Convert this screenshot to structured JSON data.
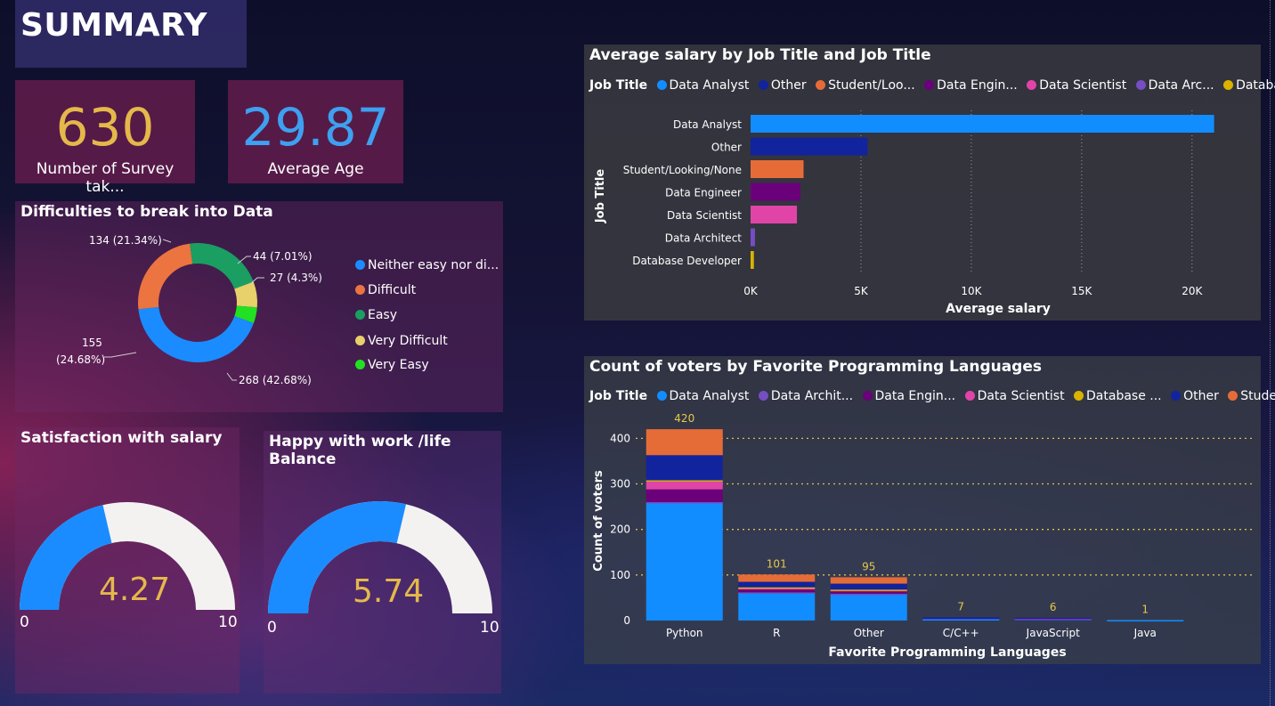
{
  "page_title": "SUMMARY",
  "kpis": {
    "surveys": {
      "value": "630",
      "label": "Number of Survey tak..."
    },
    "age": {
      "value": "29.87",
      "label": "Average Age"
    }
  },
  "colors": {
    "kpi_survey": "#e5b84a",
    "kpi_age": "#3ea0f0",
    "gauge_fill": "#1a8cff",
    "gauge_empty": "#f3f2f1",
    "gauge_value": "#e5b84a"
  },
  "difficulty": {
    "title": "Difficulties to break into Data",
    "legend": [
      {
        "label": "Neither easy nor di...",
        "color": "#1a8cff"
      },
      {
        "label": "Difficult",
        "color": "#ec7440"
      },
      {
        "label": "Easy",
        "color": "#1a9e62"
      },
      {
        "label": "Very Difficult",
        "color": "#e8d06a"
      },
      {
        "label": "Very Easy",
        "color": "#22e022"
      }
    ],
    "slice_labels": {
      "easy": "134 (21.34%)",
      "very_difficult": "44 (7.01%)",
      "very_easy": "27 (4.3%)",
      "difficult_count": "155",
      "difficult_pct": "(24.68%)",
      "neither": "268 (42.68%)"
    }
  },
  "gauges": {
    "salary": {
      "title": "Satisfaction with salary",
      "value": "4.27",
      "min": "0",
      "max": "10"
    },
    "balance": {
      "title": "Happy with work /life Balance",
      "value": "5.74",
      "min": "0",
      "max": "10"
    }
  },
  "salary_chart": {
    "title": "Average salary by Job Title and Job Title",
    "legend_title": "Job Title",
    "legend": [
      {
        "label": "Data Analyst",
        "color": "#118dff"
      },
      {
        "label": "Other",
        "color": "#12239e"
      },
      {
        "label": "Student/Loo...",
        "color": "#e66c37"
      },
      {
        "label": "Data Engin...",
        "color": "#6b007b"
      },
      {
        "label": "Data Scientist",
        "color": "#e044a7"
      },
      {
        "label": "Data Arc...",
        "color": "#744ec2"
      },
      {
        "label": "Database ...",
        "color": "#d9b300"
      }
    ],
    "ylabel": "Job Title",
    "xlabel": "Average salary",
    "ticks": [
      "0K",
      "5K",
      "10K",
      "15K",
      "20K"
    ]
  },
  "voters_chart": {
    "title": "Count of voters by Favorite Programming Languages",
    "legend_title": "Job Title",
    "legend": [
      {
        "label": "Data Analyst",
        "color": "#118dff"
      },
      {
        "label": "Data Archit...",
        "color": "#744ec2"
      },
      {
        "label": "Data Engin...",
        "color": "#6b007b"
      },
      {
        "label": "Data Scientist",
        "color": "#e044a7"
      },
      {
        "label": "Database ...",
        "color": "#d9b300"
      },
      {
        "label": "Other",
        "color": "#12239e"
      },
      {
        "label": "Student/L...",
        "color": "#e66c37"
      }
    ],
    "ylabel": "Count of voters",
    "xlabel": "Favorite Programming Languages"
  },
  "chart_data": [
    {
      "type": "pie",
      "title": "Difficulties to break into Data",
      "categories": [
        "Neither easy nor difficult",
        "Difficult",
        "Easy",
        "Very Difficult",
        "Very Easy"
      ],
      "values": [
        268,
        155,
        134,
        44,
        27
      ],
      "colors": [
        "#1a8cff",
        "#ec7440",
        "#1a9e62",
        "#e8d06a",
        "#22e022"
      ]
    },
    {
      "type": "bar",
      "orientation": "horizontal",
      "title": "Average salary by Job Title and Job Title",
      "categories": [
        "Data Analyst",
        "Other",
        "Student/Looking/None",
        "Data Engineer",
        "Data Scientist",
        "Data Architect",
        "Database Developer"
      ],
      "values": [
        21000,
        5300,
        2400,
        2250,
        2100,
        200,
        150
      ],
      "colors": [
        "#118dff",
        "#12239e",
        "#e66c37",
        "#6b007b",
        "#e044a7",
        "#744ec2",
        "#d9b300"
      ],
      "xlabel": "Average salary",
      "ylabel": "Job Title",
      "xlim": [
        0,
        21500
      ],
      "grid": true
    },
    {
      "type": "bar",
      "stacked": true,
      "title": "Count of voters by Favorite Programming Languages",
      "categories": [
        "Python",
        "R",
        "Other",
        "C/C++",
        "JavaScript",
        "Java"
      ],
      "totals": [
        420,
        101,
        95,
        7,
        6,
        1
      ],
      "series": [
        {
          "name": "Data Analyst",
          "color": "#118dff",
          "values": [
            258,
            61,
            58,
            5,
            3,
            1
          ]
        },
        {
          "name": "Data Architect",
          "color": "#744ec2",
          "values": [
            2,
            1,
            1,
            0,
            0,
            0
          ]
        },
        {
          "name": "Data Engineer",
          "color": "#6b007b",
          "values": [
            28,
            6,
            5,
            1,
            1,
            0
          ]
        },
        {
          "name": "Data Scientist",
          "color": "#e044a7",
          "values": [
            18,
            4,
            3,
            0,
            1,
            0
          ]
        },
        {
          "name": "Database Developer",
          "color": "#d9b300",
          "values": [
            2,
            1,
            1,
            0,
            0,
            0
          ]
        },
        {
          "name": "Other",
          "color": "#12239e",
          "values": [
            55,
            12,
            13,
            1,
            1,
            0
          ]
        },
        {
          "name": "Student/Looking/None",
          "color": "#e66c37",
          "values": [
            57,
            16,
            14,
            0,
            0,
            0
          ]
        }
      ],
      "xlabel": "Favorite Programming Languages",
      "ylabel": "Count of voters",
      "yticks": [
        0,
        100,
        200,
        300,
        400
      ],
      "ylim": [
        0,
        430
      ],
      "grid": true
    }
  ]
}
